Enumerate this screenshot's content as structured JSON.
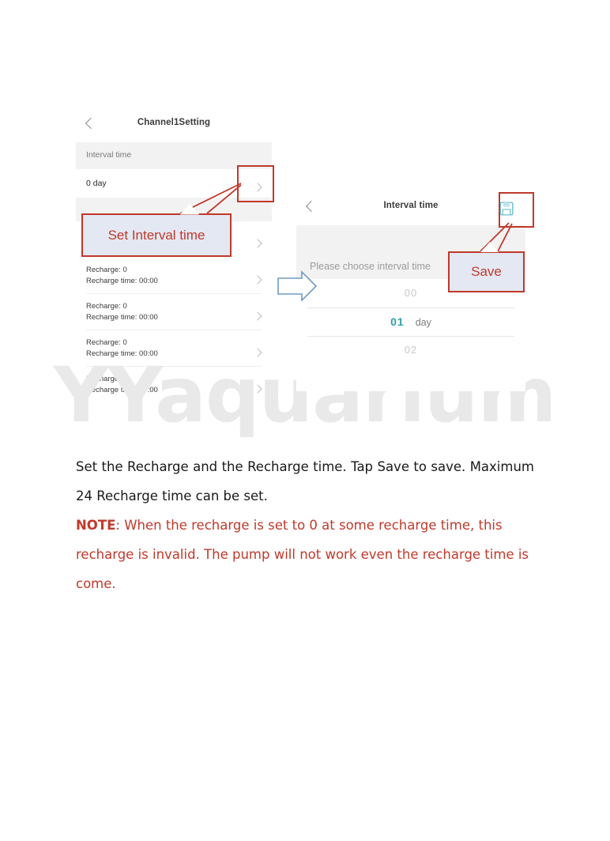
{
  "figure": {
    "watermark": "YYaquarium",
    "left_phone": {
      "back_icon": "chevron-left-icon",
      "title": "Channel1Setting",
      "interval_section_label": "Interval time",
      "interval_value_row": {
        "label": "0 day",
        "chevron": "chevron-right-icon"
      },
      "recharge_rows": [
        {
          "recharge": "Recharge: 0",
          "time": "Recharge time:  00:00",
          "chevron": "chevron-right-icon"
        },
        {
          "recharge": "Recharge: 0",
          "time": "Recharge time:  00:00",
          "chevron": "chevron-right-icon"
        },
        {
          "recharge": "Recharge: 0",
          "time": "Recharge time:  00:00",
          "chevron": "chevron-right-icon"
        },
        {
          "recharge": "Recharge: 0",
          "time": "Recharge time:  00:00",
          "chevron": "chevron-right-icon"
        }
      ],
      "hidden_row_chevron": "chevron-right-icon"
    },
    "right_phone": {
      "back_icon": "chevron-left-icon",
      "title": "Interval time",
      "save_icon": "save-floppy-icon",
      "hint": "Please choose interval time",
      "picker": {
        "above": "00",
        "selected_value": "01",
        "selected_unit": "day",
        "below": "02"
      }
    },
    "annotations": {
      "callout_interval": "Set Interval time",
      "callout_save": "Save",
      "flow_arrow": "right-arrow-icon",
      "highlight_color": "#c0392b",
      "callout_fill": "#e3e8f2",
      "arrow_color": "#6e9bc5"
    }
  },
  "body": {
    "paragraph1": "Set the Recharge and the Recharge time. Tap Save to save. Maximum 24 Recharge time can be set.",
    "note_label": "NOTE",
    "note_sep": ": ",
    "note_text": "When the recharge is set to 0 at some recharge time, this recharge is invalid. The pump will not work even the recharge time is come."
  }
}
